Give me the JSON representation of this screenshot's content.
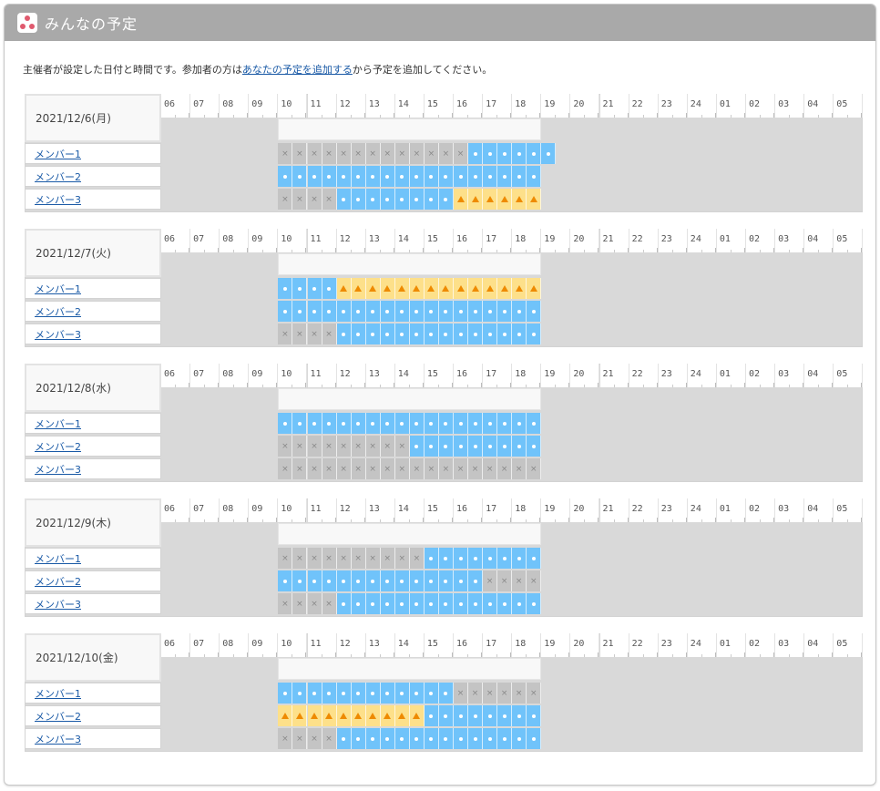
{
  "header": {
    "title": "みんなの予定"
  },
  "intro": {
    "before": "主催者が設定した日付と時間です。参加者の方は",
    "link": "あなたの予定を追加する",
    "after": "から予定を追加してください。"
  },
  "hours": [
    "06",
    "07",
    "08",
    "09",
    "10",
    "11",
    "12",
    "13",
    "14",
    "15",
    "16",
    "17",
    "18",
    "19",
    "20",
    "21",
    "22",
    "23",
    "24",
    "01",
    "02",
    "03",
    "04",
    "05"
  ],
  "organizer_window": {
    "start_hour": "10",
    "end_hour": "19"
  },
  "legend_marks": {
    "ok": "circle",
    "ng": "cross",
    "maybe": "triangle"
  },
  "days": [
    {
      "date": "2021/12/6(月)",
      "members": [
        {
          "name": "メンバー1",
          "slots": "nnnnnnnnnnnnnoooooo"
        },
        {
          "name": "メンバー2",
          "slots": "oooooooooooooooooo"
        },
        {
          "name": "メンバー3",
          "slots": "nnnnoooooooommmmmm"
        }
      ]
    },
    {
      "date": "2021/12/7(火)",
      "members": [
        {
          "name": "メンバー1",
          "slots": "oooommmmmmmmmmmmmm"
        },
        {
          "name": "メンバー2",
          "slots": "oooooooooooooooooo"
        },
        {
          "name": "メンバー3",
          "slots": "nnnnoooooooooooooo"
        }
      ]
    },
    {
      "date": "2021/12/8(水)",
      "members": [
        {
          "name": "メンバー1",
          "slots": "oooooooooooooooooo"
        },
        {
          "name": "メンバー2",
          "slots": "nnnnnnnnnooooooooo"
        },
        {
          "name": "メンバー3",
          "slots": "nnnnnnnnnnnnnnnnnn"
        }
      ]
    },
    {
      "date": "2021/12/9(木)",
      "members": [
        {
          "name": "メンバー1",
          "slots": "nnnnnnnnnnoooooooo"
        },
        {
          "name": "メンバー2",
          "slots": "oooooooooooooonnnn"
        },
        {
          "name": "メンバー3",
          "slots": "nnnnoooooooooooooo"
        }
      ]
    },
    {
      "date": "2021/12/10(金)",
      "members": [
        {
          "name": "メンバー1",
          "slots": "oooooooooooonnnnnn"
        },
        {
          "name": "メンバー2",
          "slots": "mmmmmmmmmmoooooooo"
        },
        {
          "name": "メンバー3",
          "slots": "nnnnoooooooooooooo"
        }
      ]
    }
  ],
  "colors": {
    "ok": "#70c3fa",
    "ng": "#c4c4c4",
    "maybe": "#fde08a",
    "header": "#a9a9a9"
  }
}
